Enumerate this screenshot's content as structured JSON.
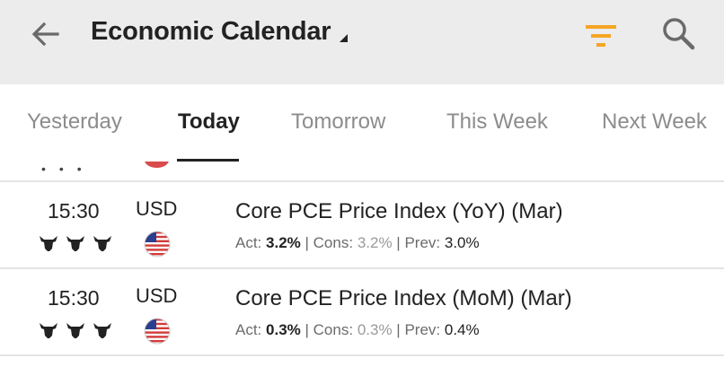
{
  "header": {
    "title": "Economic Calendar",
    "accent_color": "#f5a623",
    "icons": {
      "back": "arrow-left-icon",
      "filter": "filter-icon",
      "search": "search-icon"
    }
  },
  "tabs": [
    {
      "label": "Yesterday",
      "active": false
    },
    {
      "label": "Today",
      "active": true
    },
    {
      "label": "Tomorrow",
      "active": false
    },
    {
      "label": "This Week",
      "active": false
    },
    {
      "label": "Next Week",
      "active": false
    }
  ],
  "events": [
    {
      "time": "15:30",
      "importance": 3,
      "currency": "USD",
      "country_flag": "us-flag-icon",
      "name": "Core PCE Price Index (YoY) (Mar)",
      "act_label": "Act:",
      "act_value": "3.2%",
      "cons_label": "Cons:",
      "cons_value": "3.2%",
      "prev_label": "Prev:",
      "prev_value": "3.0%"
    },
    {
      "time": "15:30",
      "importance": 3,
      "currency": "USD",
      "country_flag": "us-flag-icon",
      "name": "Core PCE Price Index (MoM) (Mar)",
      "act_label": "Act:",
      "act_value": "0.3%",
      "cons_label": "Cons:",
      "cons_value": "0.3%",
      "prev_label": "Prev:",
      "prev_value": "0.4%"
    }
  ]
}
